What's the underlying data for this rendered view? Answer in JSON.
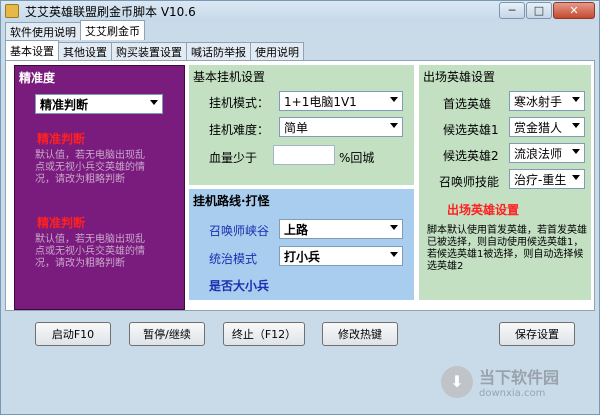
{
  "window": {
    "title": "艾艾英雄联盟刷金币脚本 V10.6",
    "minimize": "─",
    "maximize": "□",
    "close": "✕"
  },
  "top_tabs": [
    "软件使用说明",
    "艾艾刷金币"
  ],
  "inner_tabs": [
    "基本设置",
    "其他设置",
    "购买装置设置",
    "喊话防举报",
    "使用说明"
  ],
  "precision": {
    "title": "精准度",
    "select_value": "精准判断",
    "sections": [
      {
        "heading": "精准判断",
        "text": "默认值，若无电脑出现乱点或无视小兵交英雄的情况，请改为粗略判断"
      },
      {
        "heading": "精准判断",
        "text": "默认值，若无电脑出现乱点或无视小兵交英雄的情况，请改为粗略判断"
      }
    ]
  },
  "basic": {
    "title": "基本挂机设置",
    "mode_label": "挂机模式：",
    "mode_value": "1+1电脑1V1",
    "difficulty_label": "挂机难度：",
    "difficulty_value": "简单",
    "hp_label": "血量少于",
    "hp_value": "",
    "hp_suffix": "%回城"
  },
  "route": {
    "title": "挂机路线·打怪",
    "map_label": "召唤师峡谷",
    "map_value": "上路",
    "mode_label": "统治模式",
    "mode_value": "打小兵",
    "size_label": "是否大小兵"
  },
  "hero": {
    "title": "出场英雄设置",
    "rows": [
      {
        "label": "首选英雄",
        "value": "寒冰射手"
      },
      {
        "label": "候选英雄1",
        "value": "赏金猎人"
      },
      {
        "label": "候选英雄2",
        "value": "流浪法师"
      },
      {
        "label": "召唤师技能",
        "value": "治疗-重生"
      }
    ],
    "heading": "出场英雄设置",
    "description": "脚本默认使用首发英雄，若首发英雄已被选择，则自动使用候选英雄1，若候选英雄1被选择，则自动选择候选英雄2"
  },
  "buttons": {
    "start": "启动F10",
    "pause": "暂停/继续",
    "stop": "终止（F12）",
    "hotkey": "修改热键",
    "save": "保存设置"
  },
  "watermark": {
    "name": "当下软件园",
    "url": "downxia.com"
  }
}
